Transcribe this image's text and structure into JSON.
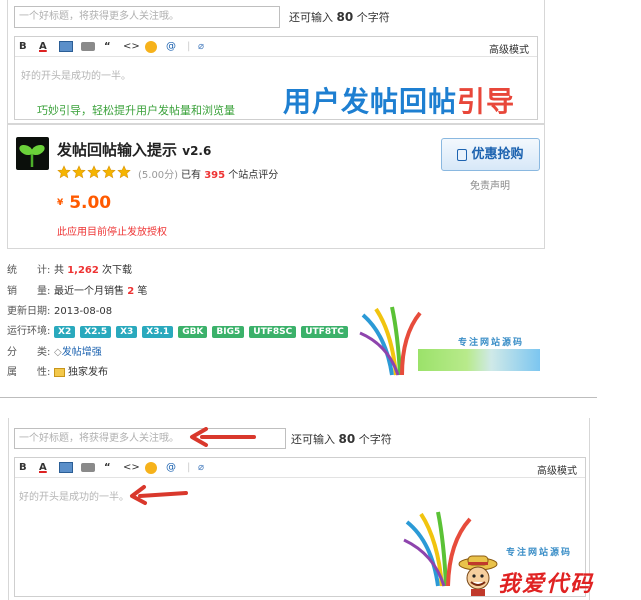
{
  "top_editor": {
    "title_placeholder": "一个好标题，将获得更多人关注哦。",
    "remain_prefix": "还可输入",
    "remain_count": "80",
    "remain_suffix": "个字符",
    "advanced_mode": "高级模式",
    "body_placeholder": "好的开头是成功的一半。",
    "slogan": "巧妙引导，轻松提升用户发帖量和浏览量",
    "headline_blue": "用户发帖回帖",
    "headline_red": "引导"
  },
  "product": {
    "name": "发帖回帖输入提示",
    "version": "v2.6",
    "score": "(5.00分)",
    "rating_prefix": "已有",
    "rating_count": "395",
    "rating_suffix": "个站点评分",
    "currency": "¥",
    "price": "5.00",
    "stop_notice": "此应用目前停止发放授权",
    "buy_button": "优惠抢购",
    "disclaimer": "免责声明"
  },
  "info": {
    "stats_label": "统　　计:",
    "stats_prefix": "共",
    "stats_value": "1,262",
    "stats_suffix": "次下载",
    "sales_label": "销　　量:",
    "sales_prefix": "最近一个月销售",
    "sales_value": "2",
    "sales_suffix": "笔",
    "updated_label": "更新日期:",
    "updated_value": "2013-08-08",
    "env_label": "运行环境:",
    "env_tags": [
      "X2",
      "X2.5",
      "X3",
      "X3.1",
      "GBK",
      "BIG5",
      "UTF8SC",
      "UTF8TC"
    ],
    "category_label": "分　　类:",
    "category_value": "发帖增强",
    "attr_label": "属　　性:",
    "attr_value": "独家发布"
  },
  "brand_text": "专注网站源码",
  "bottom_editor": {
    "title_placeholder": "一个好标题，将获得更多人关注哦。",
    "remain_prefix": "还可输入",
    "remain_count": "80",
    "remain_suffix": "个字符",
    "advanced_mode": "高级模式",
    "body_placeholder": "好的开头是成功的一半。"
  },
  "watermark": "我爱代码",
  "colors": {
    "accent_blue": "#1e7fd1",
    "accent_red": "#e8473a",
    "price_orange": "#ff5a00",
    "arrow_red": "#d9382c"
  }
}
